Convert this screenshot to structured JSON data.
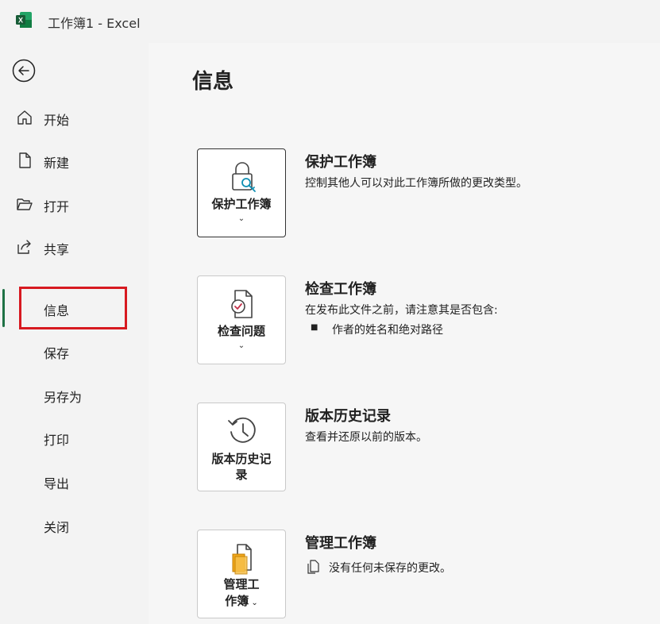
{
  "window": {
    "title": "工作簿1  -  Excel"
  },
  "sidebar": {
    "items": [
      {
        "label": "开始",
        "icon": "home-icon"
      },
      {
        "label": "新建",
        "icon": "new-file-icon"
      },
      {
        "label": "打开",
        "icon": "folder-open-icon"
      },
      {
        "label": "共享",
        "icon": "share-icon"
      },
      {
        "label": "信息",
        "icon": "",
        "active": true
      },
      {
        "label": "保存"
      },
      {
        "label": "另存为"
      },
      {
        "label": "打印"
      },
      {
        "label": "导出"
      },
      {
        "label": "关闭"
      }
    ]
  },
  "main": {
    "title": "信息",
    "sections": [
      {
        "button_label": "保护工作簿",
        "title": "保护工作簿",
        "description": "控制其他人可以对此工作簿所做的更改类型。"
      },
      {
        "button_label": "检查问题",
        "title": "检查工作簿",
        "description": "在发布此文件之前，请注意其是否包含:",
        "bullets": [
          "作者的姓名和绝对路径"
        ]
      },
      {
        "button_label_line1": "版本历史记",
        "button_label_line2": "录",
        "title": "版本历史记录",
        "description": "查看并还原以前的版本。"
      },
      {
        "button_label_line1": "管理工",
        "button_label_line2": "作簿",
        "title": "管理工作簿",
        "description": "没有任何未保存的更改。"
      }
    ]
  },
  "colors": {
    "accent_green": "#1e7145",
    "highlight_red": "#d71920",
    "folder_orange": "#f2a81d"
  }
}
